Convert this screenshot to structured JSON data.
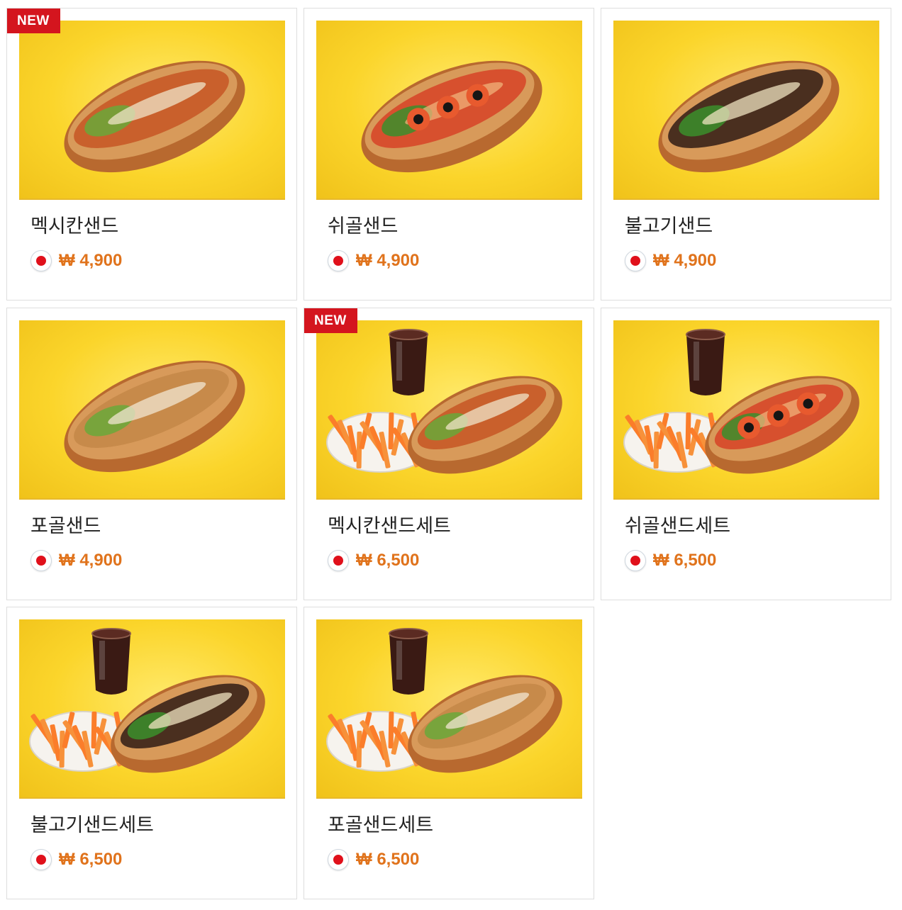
{
  "menu": [
    {
      "name": "멕시칸샌드",
      "price": "₩ 4,900",
      "badge": "NEW",
      "has_badge": "true",
      "image": "mexican-sandwich",
      "is_set": "false",
      "filling": "mexican"
    },
    {
      "name": "쉬골샌드",
      "price": "₩ 4,900",
      "badge": "",
      "has_badge": "false",
      "image": "shrimp-sandwich",
      "is_set": "false",
      "filling": "shrimp"
    },
    {
      "name": "불고기샌드",
      "price": "₩ 4,900",
      "badge": "",
      "has_badge": "false",
      "image": "bulgogi-sandwich",
      "is_set": "false",
      "filling": "bulgogi"
    },
    {
      "name": "포골샌드",
      "price": "₩ 4,900",
      "badge": "",
      "has_badge": "false",
      "image": "pork-sandwich",
      "is_set": "false",
      "filling": "pork"
    },
    {
      "name": "멕시칸샌드세트",
      "price": "₩ 6,500",
      "badge": "NEW",
      "has_badge": "true",
      "image": "mexican-sandwich-set",
      "is_set": "true",
      "filling": "mexican"
    },
    {
      "name": "쉬골샌드세트",
      "price": "₩ 6,500",
      "badge": "",
      "has_badge": "false",
      "image": "shrimp-sandwich-set",
      "is_set": "true",
      "filling": "shrimp"
    },
    {
      "name": "불고기샌드세트",
      "price": "₩ 6,500",
      "badge": "",
      "has_badge": "false",
      "image": "bulgogi-sandwich-set",
      "is_set": "true",
      "filling": "bulgogi"
    },
    {
      "name": "포골샌드세트",
      "price": "₩ 6,500",
      "badge": "",
      "has_badge": "false",
      "image": "pork-sandwich-set",
      "is_set": "true",
      "filling": "pork"
    }
  ],
  "colors": {
    "badge_red": "#d4151e",
    "price_orange": "#e0731c",
    "photo_yellow": "#fbd52b",
    "flag_red": "#e0101b"
  },
  "icons": {
    "currency_flag": "japan-flag-icon"
  }
}
